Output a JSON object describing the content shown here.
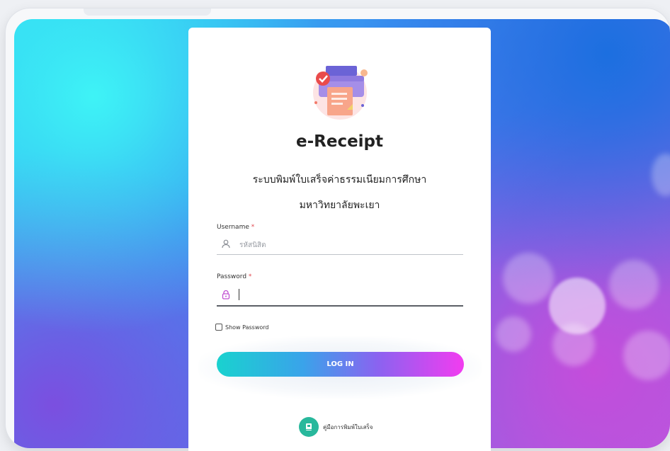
{
  "app": {
    "title": "e-Receipt",
    "subtitle_line1": "ระบบพิมพ์ใบเสร็จค่าธรรมเนียมการศึกษา",
    "subtitle_line2": "มหาวิทยาลัยพะเยา"
  },
  "form": {
    "username": {
      "label": "Username",
      "required_mark": "*",
      "placeholder": "รหัสนิสิต",
      "value": "",
      "icon": "user-icon"
    },
    "password": {
      "label": "Password",
      "required_mark": "*",
      "value": "",
      "icon": "lock-icon"
    },
    "show_password": {
      "label": "Show Password",
      "checked": false
    },
    "login_button": "LOG IN"
  },
  "footer": {
    "manual_label": "คู่มือการพิมพ์ใบเสร็จ",
    "manual_icon": "book-icon"
  },
  "colors": {
    "accent_teal": "#19d2cf",
    "accent_magenta": "#f23cf0",
    "required": "#e0484f",
    "lock_icon": "#c04fd1",
    "manual_icon_bg": "#28b89c"
  }
}
